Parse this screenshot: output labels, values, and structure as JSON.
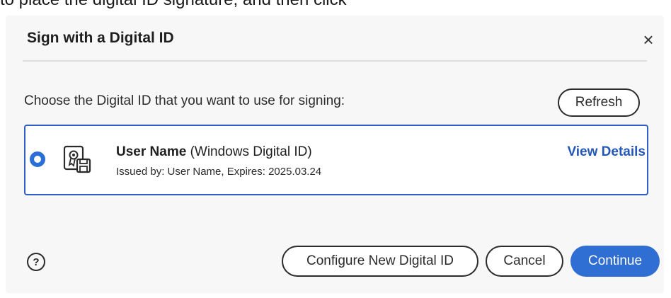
{
  "top_fragment": "to place the digital ID signature, and then click",
  "dialog": {
    "title": "Sign with a Digital ID",
    "close_glyph": "×",
    "close_icon": "close-icon",
    "prompt": "Choose the Digital ID that you want to use for signing:",
    "refresh_label": "Refresh",
    "digital_id": {
      "selected": true,
      "icon": "certificate-icon",
      "name": "User Name",
      "type": "(Windows Digital ID)",
      "issued": "Issued by: User Name, Expires: 2025.03.24",
      "view_details_label": "View Details"
    },
    "help_glyph": "?",
    "help_icon": "help-icon",
    "buttons": {
      "configure_label": "Configure New Digital ID",
      "cancel_label": "Cancel",
      "continue_label": "Continue"
    }
  },
  "colors": {
    "accent": "#2f6fd3",
    "selection_border": "#2f5fc4",
    "link": "#2457b8"
  }
}
